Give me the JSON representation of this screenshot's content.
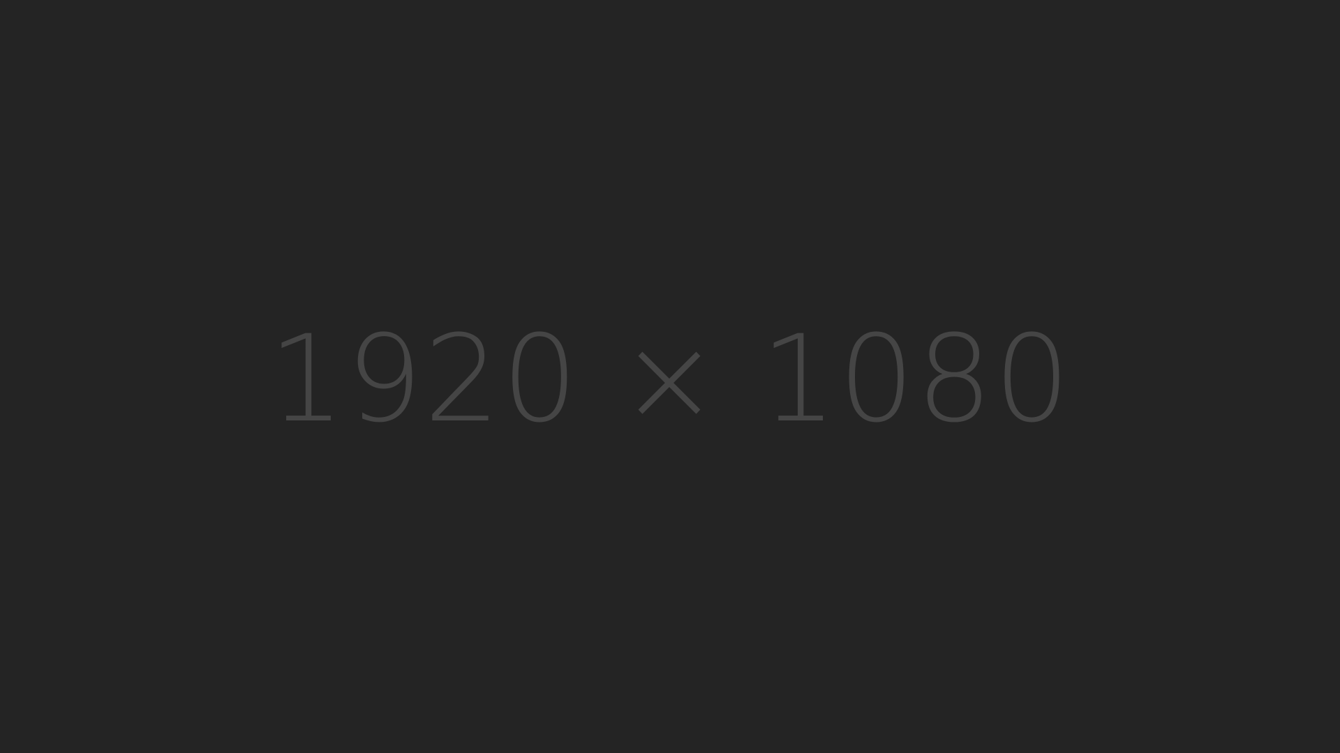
{
  "placeholder": {
    "dimension_text": "1920 × 1080",
    "background_color": "#242424",
    "text_color": "#454545"
  }
}
